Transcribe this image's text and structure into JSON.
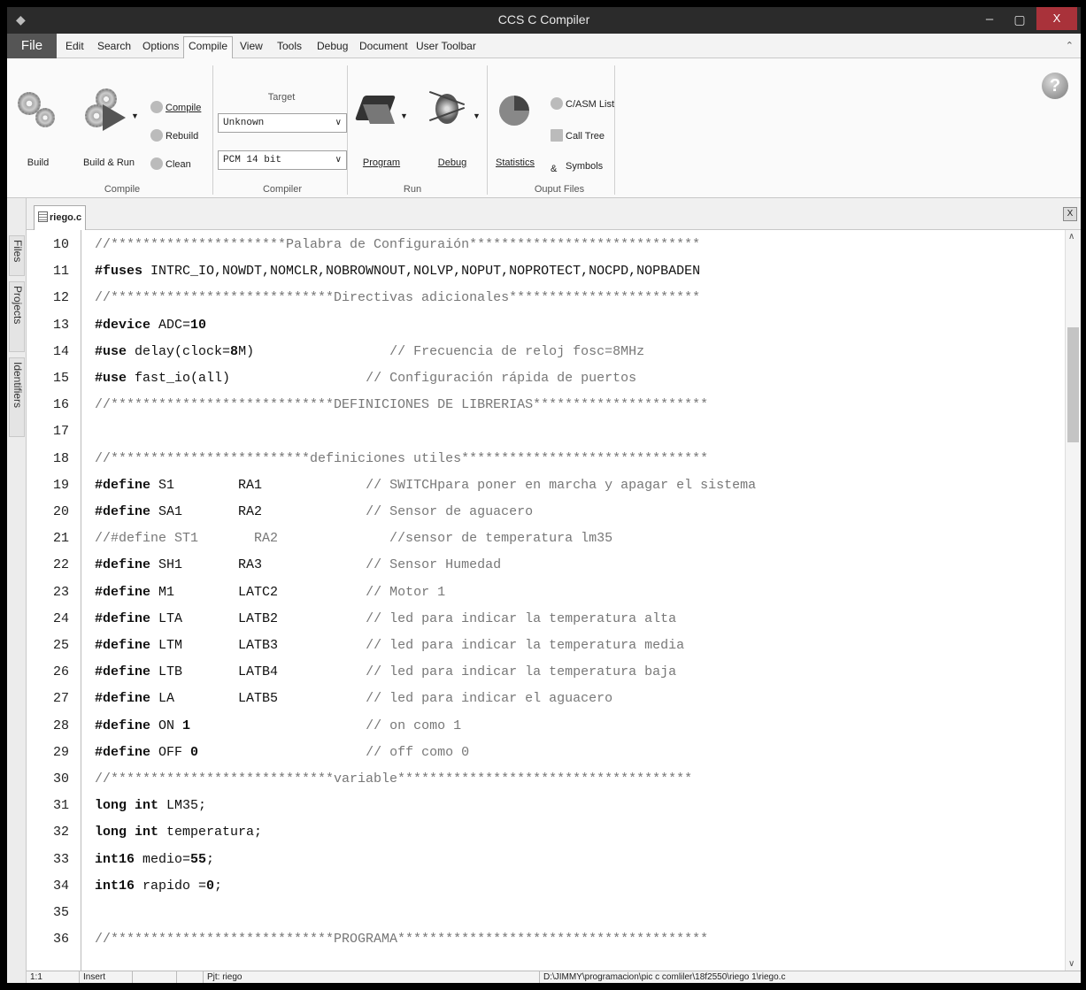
{
  "window": {
    "title": "CCS C Compiler",
    "minimize": "–",
    "maximize": "▢",
    "close": "X"
  },
  "menu": {
    "file": "File",
    "items": [
      "Edit",
      "Search",
      "Options",
      "Compile",
      "View",
      "Tools",
      "Debug",
      "Document",
      "User Toolbar"
    ]
  },
  "ribbon": {
    "compile_group": {
      "build": "Build",
      "build_run": "Build & Run",
      "compile": "Compile",
      "rebuild": "Rebuild",
      "clean": "Clean",
      "label": "Compile"
    },
    "compiler_group": {
      "target_label": "Target",
      "target_value": "Unknown",
      "pcm_value": "PCM 14 bit",
      "label": "Compiler"
    },
    "run_group": {
      "program": "Program",
      "debug": "Debug",
      "label": "Run"
    },
    "output_group": {
      "statistics": "Statistics",
      "c_asm_list": "C/ASM List",
      "call_tree": "Call Tree",
      "symbols": "Symbols",
      "label": "Ouput Files"
    }
  },
  "side_tabs": [
    "Files",
    "Projects",
    "Identifiers"
  ],
  "editor": {
    "file_tab": "riego.c",
    "close_tab": "X",
    "lines": [
      {
        "n": "10",
        "segs": [
          {
            "t": "//**********************Palabra de Configuraión*****************************",
            "c": "cm"
          }
        ]
      },
      {
        "n": "11",
        "segs": [
          {
            "t": "#fuses",
            "c": "kw"
          },
          {
            "t": " INTRC_IO,NOWDT,NOMCLR,NOBROWNOUT,NOLVP,NOPUT,NOPROTECT,NOCPD,NOPBADEN",
            "c": ""
          }
        ]
      },
      {
        "n": "12",
        "segs": [
          {
            "t": "//****************************Directivas adicionales************************",
            "c": "cm"
          }
        ]
      },
      {
        "n": "13",
        "segs": [
          {
            "t": "#device",
            "c": "kw"
          },
          {
            "t": " ADC=",
            "c": ""
          },
          {
            "t": "10",
            "c": "kw"
          }
        ]
      },
      {
        "n": "14",
        "segs": [
          {
            "t": "#use",
            "c": "kw"
          },
          {
            "t": " delay(clock=",
            "c": ""
          },
          {
            "t": "8",
            "c": "kw"
          },
          {
            "t": "M)                 ",
            "c": ""
          },
          {
            "t": "// Frecuencia de reloj fosc=8MHz",
            "c": "cm"
          }
        ]
      },
      {
        "n": "15",
        "segs": [
          {
            "t": "#use",
            "c": "kw"
          },
          {
            "t": " fast_io(all)                 ",
            "c": ""
          },
          {
            "t": "// Configuración rápida de puertos",
            "c": "cm"
          }
        ]
      },
      {
        "n": "16",
        "segs": [
          {
            "t": "//****************************DEFINICIONES DE LIBRERIAS**********************",
            "c": "cm"
          }
        ]
      },
      {
        "n": "17",
        "segs": []
      },
      {
        "n": "18",
        "segs": [
          {
            "t": "//*************************definiciones utiles*******************************",
            "c": "cm"
          }
        ]
      },
      {
        "n": "19",
        "segs": [
          {
            "t": "#define",
            "c": "kw"
          },
          {
            "t": " S1        RA1             ",
            "c": ""
          },
          {
            "t": "// SWITCHpara poner en marcha y apagar el sistema",
            "c": "cm"
          }
        ]
      },
      {
        "n": "20",
        "segs": [
          {
            "t": "#define",
            "c": "kw"
          },
          {
            "t": " SA1       RA2             ",
            "c": ""
          },
          {
            "t": "// Sensor de aguacero",
            "c": "cm"
          }
        ]
      },
      {
        "n": "21",
        "segs": [
          {
            "t": "//#define ST1       RA2              //sensor de temperatura lm35",
            "c": "cm"
          }
        ]
      },
      {
        "n": "22",
        "segs": [
          {
            "t": "#define",
            "c": "kw"
          },
          {
            "t": " SH1       RA3             ",
            "c": ""
          },
          {
            "t": "// Sensor Humedad",
            "c": "cm"
          }
        ]
      },
      {
        "n": "23",
        "segs": [
          {
            "t": "#define",
            "c": "kw"
          },
          {
            "t": " M1        LATC2           ",
            "c": ""
          },
          {
            "t": "// Motor 1",
            "c": "cm"
          }
        ]
      },
      {
        "n": "24",
        "segs": [
          {
            "t": "#define",
            "c": "kw"
          },
          {
            "t": " LTA       LATB2           ",
            "c": ""
          },
          {
            "t": "// led para indicar la temperatura alta",
            "c": "cm"
          }
        ]
      },
      {
        "n": "25",
        "segs": [
          {
            "t": "#define",
            "c": "kw"
          },
          {
            "t": " LTM       LATB3           ",
            "c": ""
          },
          {
            "t": "// led para indicar la temperatura media",
            "c": "cm"
          }
        ]
      },
      {
        "n": "26",
        "segs": [
          {
            "t": "#define",
            "c": "kw"
          },
          {
            "t": " LTB       LATB4           ",
            "c": ""
          },
          {
            "t": "// led para indicar la temperatura baja",
            "c": "cm"
          }
        ]
      },
      {
        "n": "27",
        "segs": [
          {
            "t": "#define",
            "c": "kw"
          },
          {
            "t": " LA        LATB5           ",
            "c": ""
          },
          {
            "t": "// led para indicar el aguacero",
            "c": "cm"
          }
        ]
      },
      {
        "n": "28",
        "segs": [
          {
            "t": "#define",
            "c": "kw"
          },
          {
            "t": " ON ",
            "c": ""
          },
          {
            "t": "1",
            "c": "kw"
          },
          {
            "t": "                      ",
            "c": ""
          },
          {
            "t": "// on como 1",
            "c": "cm"
          }
        ]
      },
      {
        "n": "29",
        "segs": [
          {
            "t": "#define",
            "c": "kw"
          },
          {
            "t": " OFF ",
            "c": ""
          },
          {
            "t": "0",
            "c": "kw"
          },
          {
            "t": "                     ",
            "c": ""
          },
          {
            "t": "// off como 0",
            "c": "cm"
          }
        ]
      },
      {
        "n": "30",
        "segs": [
          {
            "t": "//****************************variable*************************************",
            "c": "cm"
          }
        ]
      },
      {
        "n": "31",
        "segs": [
          {
            "t": "long int",
            "c": "kw"
          },
          {
            "t": " LM35;",
            "c": ""
          }
        ]
      },
      {
        "n": "32",
        "segs": [
          {
            "t": "long int",
            "c": "kw"
          },
          {
            "t": " temperatura;",
            "c": ""
          }
        ]
      },
      {
        "n": "33",
        "segs": [
          {
            "t": "int16",
            "c": "kw"
          },
          {
            "t": " medio=",
            "c": ""
          },
          {
            "t": "55",
            "c": "kw"
          },
          {
            "t": ";",
            "c": ""
          }
        ]
      },
      {
        "n": "34",
        "segs": [
          {
            "t": "int16",
            "c": "kw"
          },
          {
            "t": " rapido =",
            "c": ""
          },
          {
            "t": "0",
            "c": "kw"
          },
          {
            "t": ";",
            "c": ""
          }
        ]
      },
      {
        "n": "35",
        "segs": []
      },
      {
        "n": "36",
        "segs": [
          {
            "t": "//****************************PROGRAMA***************************************",
            "c": "cm"
          }
        ]
      }
    ]
  },
  "status": {
    "position": "1:1",
    "mode": "Insert",
    "project": "Pjt: riego",
    "path": "D:\\JIMMY\\programacion\\pic c comliler\\18f2550\\riego 1\\riego.c"
  },
  "icons": [
    "app-icon",
    "build-icon",
    "build-run-icon",
    "compile-icon",
    "rebuild-icon",
    "clean-icon",
    "program-icon",
    "debug-icon",
    "statistics-icon",
    "asm-list-icon",
    "call-tree-icon",
    "symbols-icon",
    "help-icon",
    "file-icon"
  ]
}
